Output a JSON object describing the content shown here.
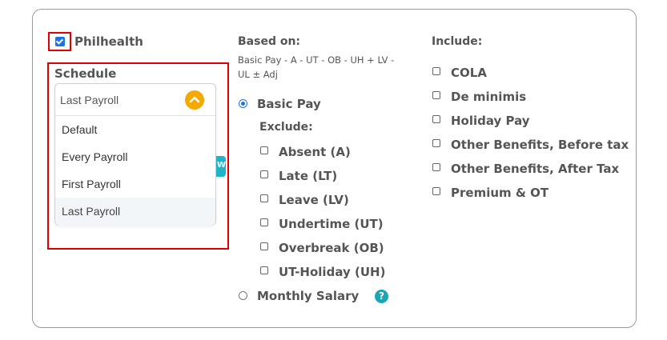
{
  "philhealth": {
    "label": "Philhealth",
    "checked": true
  },
  "schedule": {
    "heading": "Schedule",
    "selected": "Last Payroll",
    "options": [
      "Default",
      "Every Payroll",
      "First Payroll",
      "Last Payroll"
    ]
  },
  "based_on": {
    "heading": "Based on:",
    "formula_line1": "Basic Pay - A - UT - OB - UH + LV -",
    "formula_line2": "UL ± Adj",
    "basic_pay_label": "Basic Pay",
    "exclude_heading": "Exclude:",
    "exclude_items": [
      "Absent (A)",
      "Late (LT)",
      "Leave (LV)",
      "Undertime (UT)",
      "Overbreak (OB)",
      "UT-Holiday (UH)"
    ],
    "monthly_salary_label": "Monthly Salary",
    "help_glyph": "?"
  },
  "include": {
    "heading": "Include:",
    "items": [
      "COLA",
      "De minimis",
      "Holiday Pay",
      "Other Benefits, Before tax",
      "Other Benefits, After Tax",
      "Premium & OT"
    ]
  },
  "teal_tab_glyph": "W",
  "colors": {
    "highlight": "#e00000",
    "accent": "#1a73e8",
    "toggle": "#f5a800",
    "teal": "#1fb4c8"
  },
  "icons": {
    "dropdown_toggle": "chevron-up-icon",
    "help": "question-circle-icon"
  }
}
